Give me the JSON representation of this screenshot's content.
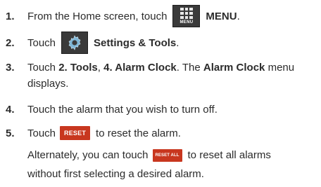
{
  "steps": [
    {
      "number": "1.",
      "before": "From the Home screen, touch",
      "button_label": "MENU",
      "after": "MENU",
      "after_suffix": "."
    },
    {
      "number": "2.",
      "before": "Touch",
      "after": "Settings & Tools",
      "after_suffix": "."
    },
    {
      "number": "3.",
      "t1": "Touch ",
      "b1": "2. Tools",
      "t2": ", ",
      "b2": "4. Alarm Clock",
      "t3": ". The ",
      "b3": "Alarm Clock",
      "t4": " menu",
      "line2": "displays."
    },
    {
      "number": "4.",
      "text": "Touch the alarm that you wish to turn off."
    },
    {
      "number": "5.",
      "before": "Touch",
      "button_label": "RESET",
      "after": "to reset the alarm.",
      "alt_before": "Alternately, you can touch",
      "alt_button_label": "RESET ALL",
      "alt_after": "to reset all alarms",
      "alt_line2": "without first selecting a desired alarm."
    }
  ],
  "colors": {
    "text": "#2b2b2b",
    "button_red": "#c8371f",
    "icon_dark": "#3a3a3a"
  },
  "icons": [
    "menu-icon",
    "settings-gear-icon"
  ]
}
